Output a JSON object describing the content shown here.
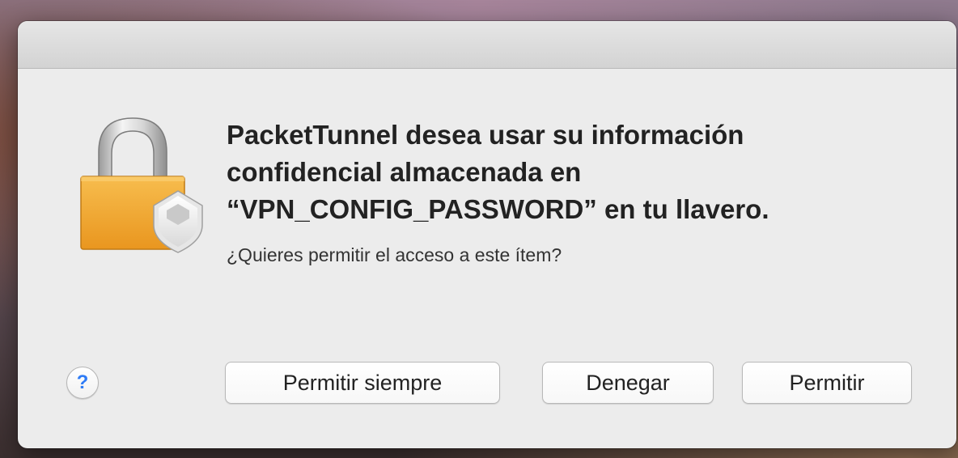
{
  "dialog": {
    "title_text": "PacketTunnel desea usar su información\nconfidencial almacenada en\n“VPN_CONFIG_PASSWORD” en tu llavero.",
    "subtitle_text": "¿Quieres permitir el acceso a este ítem?",
    "icon": "lock-icon",
    "help_label": "?",
    "buttons": {
      "always_allow": "Permitir siempre",
      "deny": "Denegar",
      "allow": "Permitir"
    }
  },
  "colors": {
    "dialog_bg": "#ececec",
    "help_accent": "#2f7cf6",
    "lock_body": "#f0a533"
  }
}
